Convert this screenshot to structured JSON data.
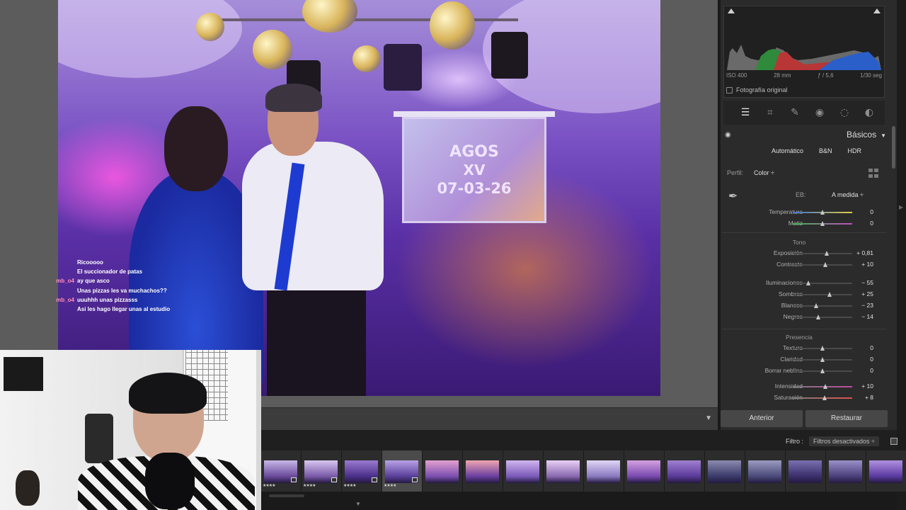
{
  "chat": [
    {
      "user": "",
      "msg": "Ricooooo"
    },
    {
      "user": "",
      "msg": "El succionador de patas"
    },
    {
      "user": "mb_o4",
      "msg": "ay que asco"
    },
    {
      "user": "",
      "msg": "Unas pizzas les va muchachos??"
    },
    {
      "user": "mb_o4",
      "msg": "uuuhhh unas pizzasss"
    },
    {
      "user": "",
      "msg": "Asi les hago llegar unas al estudio"
    }
  ],
  "photo": {
    "screen_line1": "AGOS",
    "screen_line2": "XV",
    "screen_line3": "07-03-26"
  },
  "histogram": {
    "iso": "ISO 400",
    "focal": "28 mm",
    "aperture": "ƒ / 5,6",
    "shutter": "1/30 seg",
    "original_label": "Fotografía original"
  },
  "tools": [
    {
      "icon": "sliders-icon",
      "glyph": "☰"
    },
    {
      "icon": "crop-icon",
      "glyph": "⌗"
    },
    {
      "icon": "eraser-icon",
      "glyph": "✎"
    },
    {
      "icon": "redeye-icon",
      "glyph": "◉"
    },
    {
      "icon": "masking-icon",
      "glyph": "◌"
    },
    {
      "icon": "presets-icon",
      "glyph": "◐"
    }
  ],
  "basics": {
    "title": "Básicos",
    "treatments": [
      "Automático",
      "B&N",
      "HDR"
    ],
    "profile_label": "Perfil:",
    "profile_value": "Color ÷",
    "wb_label": "EB:",
    "wb_value": "A medida ÷",
    "tone_label": "Tono",
    "presence_label": "Presencia"
  },
  "sliders": {
    "temperatura": {
      "label": "Temperatura",
      "value": "0",
      "pos": 0.5
    },
    "matiz": {
      "label": "Matiz",
      "value": "0",
      "pos": 0.5
    },
    "exposicion": {
      "label": "Exposición",
      "value": "+ 0,81",
      "pos": 0.58
    },
    "contraste": {
      "label": "Contraste",
      "value": "+ 10",
      "pos": 0.55
    },
    "iluminaciones": {
      "label": "Iluminaciones",
      "value": "− 55",
      "pos": 0.27
    },
    "sombras": {
      "label": "Sombras",
      "value": "+ 25",
      "pos": 0.62
    },
    "blancos": {
      "label": "Blancos",
      "value": "− 23",
      "pos": 0.4
    },
    "negros": {
      "label": "Negros",
      "value": "− 14",
      "pos": 0.43
    },
    "textura": {
      "label": "Textura",
      "value": "0",
      "pos": 0.5
    },
    "claridad": {
      "label": "Claridad",
      "value": "0",
      "pos": 0.5
    },
    "neblina": {
      "label": "Borrar neblina",
      "value": "0",
      "pos": 0.5
    },
    "intensidad": {
      "label": "Intensidad",
      "value": "+ 10",
      "pos": 0.55
    },
    "saturacion": {
      "label": "Saturación",
      "value": "+ 8",
      "pos": 0.54
    }
  },
  "buttons": {
    "previous": "Anterior",
    "reset": "Restaurar"
  },
  "filmstrip": {
    "filter_label": "Filtro :",
    "filter_value": "Filtros desactivados ÷",
    "thumbs": [
      {
        "stars": "★★★★",
        "badge": true
      },
      {
        "stars": "★★★★",
        "badge": true
      },
      {
        "stars": "★★★★",
        "badge": true
      },
      {
        "stars": "★★★★",
        "badge": true,
        "selected": true
      },
      {
        "stars": "",
        "badge": false
      },
      {
        "stars": "",
        "badge": false
      },
      {
        "stars": "",
        "badge": false
      },
      {
        "stars": "",
        "badge": false
      },
      {
        "stars": "",
        "badge": false
      },
      {
        "stars": "",
        "badge": false
      },
      {
        "stars": "",
        "badge": false
      },
      {
        "stars": "",
        "badge": false
      },
      {
        "stars": "",
        "badge": false
      },
      {
        "stars": "",
        "badge": false
      },
      {
        "stars": "",
        "badge": false
      },
      {
        "stars": "",
        "badge": false
      }
    ]
  }
}
